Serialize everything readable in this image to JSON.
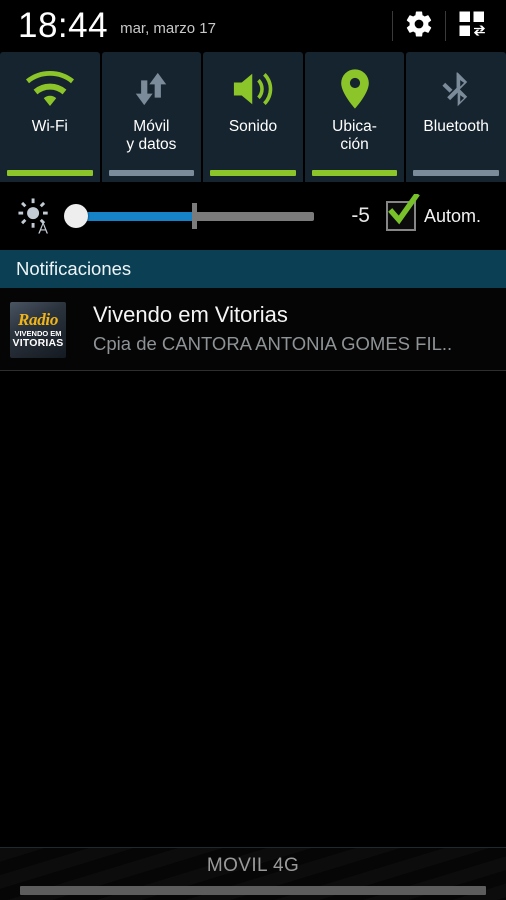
{
  "statusbar": {
    "time": "18:44",
    "date": "mar, marzo 17",
    "settings_icon": "gear-icon",
    "toggle_grid_icon": "quick-settings-grid-icon"
  },
  "quick_toggles": [
    {
      "label": "Wi-Fi",
      "icon": "wifi-icon",
      "state": "on",
      "bar_color": "#8cc529"
    },
    {
      "label": "Móvil\ny datos",
      "icon": "data-sync-icon",
      "state": "off",
      "bar_color": "#7c8b99"
    },
    {
      "label": "Sonido",
      "icon": "sound-icon",
      "state": "on",
      "bar_color": "#8cc529"
    },
    {
      "label": "Ubica-\nción",
      "icon": "location-icon",
      "state": "on",
      "bar_color": "#8cc529"
    },
    {
      "label": "Bluetooth",
      "icon": "bluetooth-icon",
      "state": "off",
      "bar_color": "#7c8b99"
    }
  ],
  "brightness": {
    "icon": "auto-brightness-icon",
    "value": "-5",
    "auto_label": "Autom.",
    "auto_checked": true,
    "slider_percent": 2,
    "fill_color": "#1683c8",
    "track_color": "#7b7b7b",
    "check_color": "#78c12a"
  },
  "notifications_section": {
    "header": "Notificaciones",
    "header_bg": "#0b4054",
    "items": [
      {
        "icon_name": "radio-vivendo-em-vitorias-app-icon",
        "icon_text_line1": "Radio",
        "icon_text_line2": "VIVENDO EM",
        "icon_text_line3": "VITORIAS",
        "title": "Vivendo em Vitorias",
        "subtitle": "Cpia de CANTORA ANTONIA GOMES  FIL.."
      }
    ]
  },
  "bottom_bar": {
    "carrier": "MOVIL 4G",
    "handle": "drag-handle"
  }
}
